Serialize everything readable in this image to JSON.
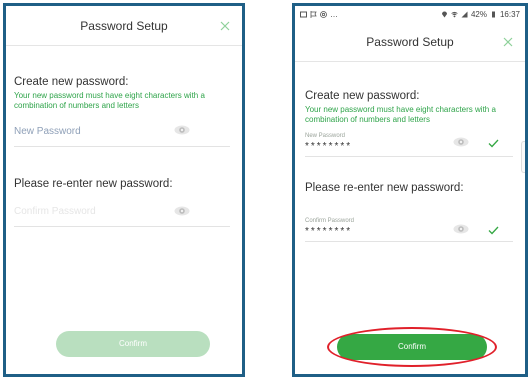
{
  "left_screen": {
    "header": {
      "title": "Password Setup"
    },
    "create": {
      "heading": "Create new password:",
      "hint": "Your new password must have eight characters with a combination of numbers and letters",
      "placeholder": "New Password"
    },
    "reenter": {
      "heading": "Please re-enter new password:",
      "placeholder": "Confirm Password"
    },
    "confirm_label": "Confirm"
  },
  "right_screen": {
    "status_bar": {
      "battery": "42%",
      "time": "16:37"
    },
    "header": {
      "title": "Password Setup"
    },
    "create": {
      "heading": "Create new password:",
      "hint": "Your new password must have eight characters with a combination of numbers and letters",
      "field_label": "New Password",
      "masked_value": "********"
    },
    "reenter": {
      "heading": "Please re-enter new password:",
      "field_label": "Confirm Password",
      "masked_value": "********"
    },
    "confirm_label": "Confirm"
  },
  "colors": {
    "frame_border": "#1f5f86",
    "hint_green": "#2fa44a",
    "button_disabled": "#b9dfbf",
    "button_enabled": "#35a844",
    "highlight": "#e0202a",
    "close_icon": "#8ed19a"
  },
  "icons": {
    "close": "close-icon",
    "eye": "eye-icon",
    "check": "check-icon"
  }
}
